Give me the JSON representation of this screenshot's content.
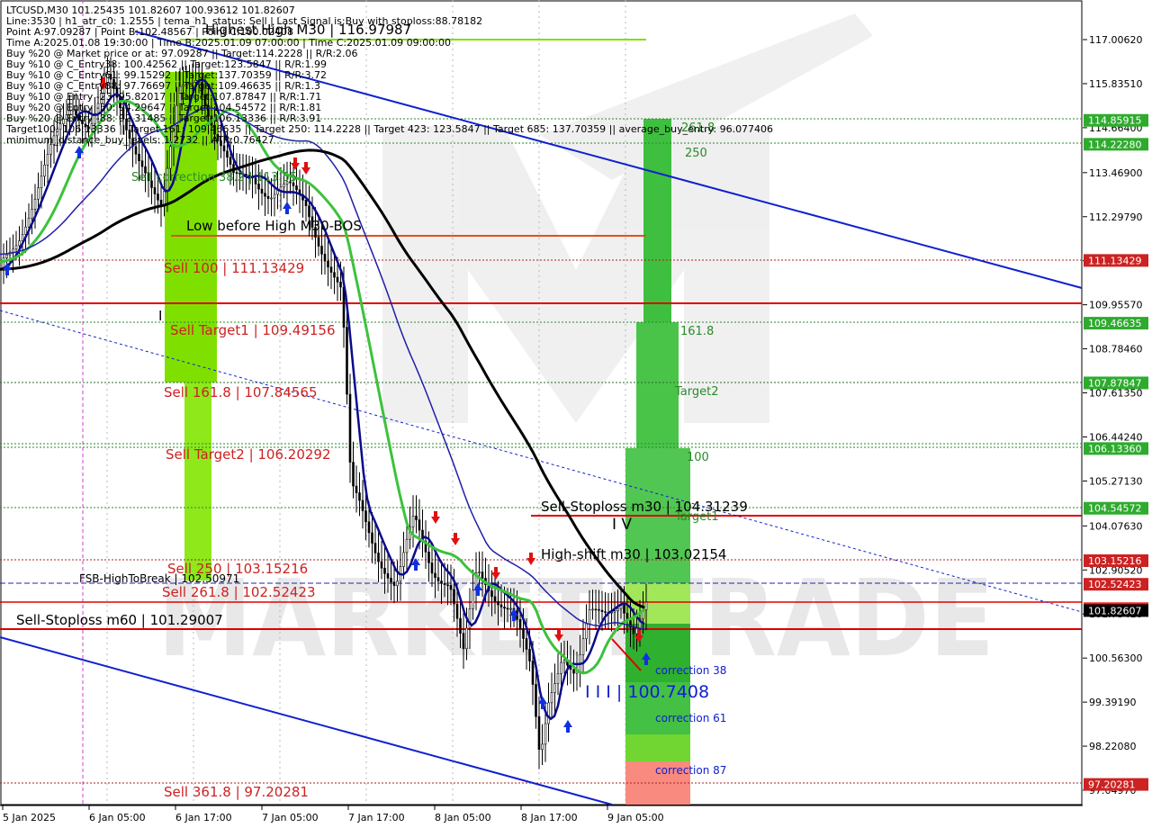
{
  "chart_data": {
    "type": "candlestick",
    "symbol": "LTCUSD",
    "timeframe": "M30",
    "watermark": "MARKETITRADE",
    "info_lines": [
      "LTCUSD,M30  101.25435 101.82607 100.93612 101.82607",
      "Line:3530 | h1_atr_c0: 1.2555 | tema_h1_status: Sell | Last Signal is:Buy with stoploss:88.78182",
      "Point A:97.09287 | Point B:102.48567 | Point C:100.02408",
      "Time A:2025.01.08 19:30:00 | Time B:2025.01.09 07:00:00 | Time C:2025.01.09 09:00:00",
      "Buy %20 @ Market price or at: 97.09287 || Target:114.2228 || R/R:2.06",
      "Buy %10 @ C_Entry38: 100.42562 || Target:123.5847 || R/R:1.99",
      "Buy %10 @ C_Entry61: 99.15292 || Target:137.70359 || R/R:3.72",
      "Buy %10 @ C_Entry88: 97.76697 || Target:109.46635 || R/R:1.3",
      "Buy %10 @ Entry -23: 95.82017 || Target:107.87847 || R/R:1.71",
      "Buy %20 @ Entry -50: 94.29647 || Target:104.54572 || R/R:1.81",
      "Buy %20 @ Entry -88: 92.31485 || Target:106.13336 || R/R:3.91",
      "Target100: 106.13336 || Target 161: 109.46635 || Target 250: 114.2228 || Target 423: 123.5847 || Target 685: 137.70359 || average_buy_entry: 96.077406",
      "minimum_distance_buy_levels: 1.2732 || ATR:0.76427"
    ],
    "y_ticks": [
      "117.00620",
      "115.83510",
      "114.66400",
      "113.46900",
      "112.29790",
      "111.12680",
      "109.95570",
      "108.78460",
      "107.61350",
      "106.44240",
      "105.27130",
      "104.07630",
      "102.90520",
      "101.73410",
      "100.56300",
      "99.39190",
      "98.22080",
      "97.04970"
    ],
    "x_ticks": [
      "5 Jan 2025",
      "6 Jan 05:00",
      "6 Jan 17:00",
      "7 Jan 05:00",
      "7 Jan 17:00",
      "8 Jan 05:00",
      "8 Jan 17:00",
      "9 Jan 05:00"
    ],
    "price_badges": [
      {
        "text": "114.85915",
        "bg": "#2eab2e"
      },
      {
        "text": "114.22280",
        "bg": "#2eab2e"
      },
      {
        "text": "111.13429",
        "bg": "#cc2222"
      },
      {
        "text": "109.46635",
        "bg": "#2eab2e"
      },
      {
        "text": "107.87847",
        "bg": "#2eab2e"
      },
      {
        "text": "106.13360",
        "bg": "#2eab2e"
      },
      {
        "text": "104.54572",
        "bg": "#2eab2e"
      },
      {
        "text": "103.15216",
        "bg": "#cc2222"
      },
      {
        "text": "102.52423",
        "bg": "#cc2222"
      },
      {
        "text": "101.87638",
        "bg": "#ff1a1a"
      },
      {
        "text": "101.82607",
        "bg": "#000000"
      },
      {
        "text": "97.20281",
        "bg": "#cc2222"
      }
    ],
    "labels": {
      "highest_high": "Highest High   M30 | 116.97987",
      "low_before_high": "Low before High   M30-BOS",
      "sell_100": "Sell 100 | 111.13429",
      "sell_target1": "Sell Target1 | 109.49156",
      "sell_161": "Sell 161.8 | 107.84565",
      "sell_target2": "Sell Target2 | 106.20292",
      "sell_250": "Sell  250 | 103.15216",
      "fsb": "FSB-HighToBreak | 102.50971",
      "sell_261": "Sell  261.8 | 102.52423",
      "sell_stoploss_m60": "Sell-Stoploss m60 | 101.29007",
      "sell_361": "Sell  361.8 | 97.20281",
      "sell_stoploss_m30": "Sell-Stoploss m30 | 104.31239",
      "high_shift": "High-shift m30 | 103.02154",
      "iv": "I V",
      "iii": "I I I | 100.7408",
      "i_mark": "I",
      "sell_correction": "Sell correction 38.2 | 113.55",
      "fib_2618": "261.8",
      "fib_250": "250",
      "fib_1618": "161.8",
      "fib_target2": "Target2",
      "fib_100": "100",
      "fib_target1": "Target1",
      "corr_38": "correction 38",
      "corr_61": "correction 61",
      "corr_87": "correction 87"
    },
    "series": [
      {
        "name": "ema_fast",
        "color": "#0a0a8c"
      },
      {
        "name": "ema_mid",
        "color": "#3cc23c"
      },
      {
        "name": "ema_slow",
        "color": "#1f1fa8"
      },
      {
        "name": "sma_long",
        "color": "#000000"
      }
    ]
  }
}
